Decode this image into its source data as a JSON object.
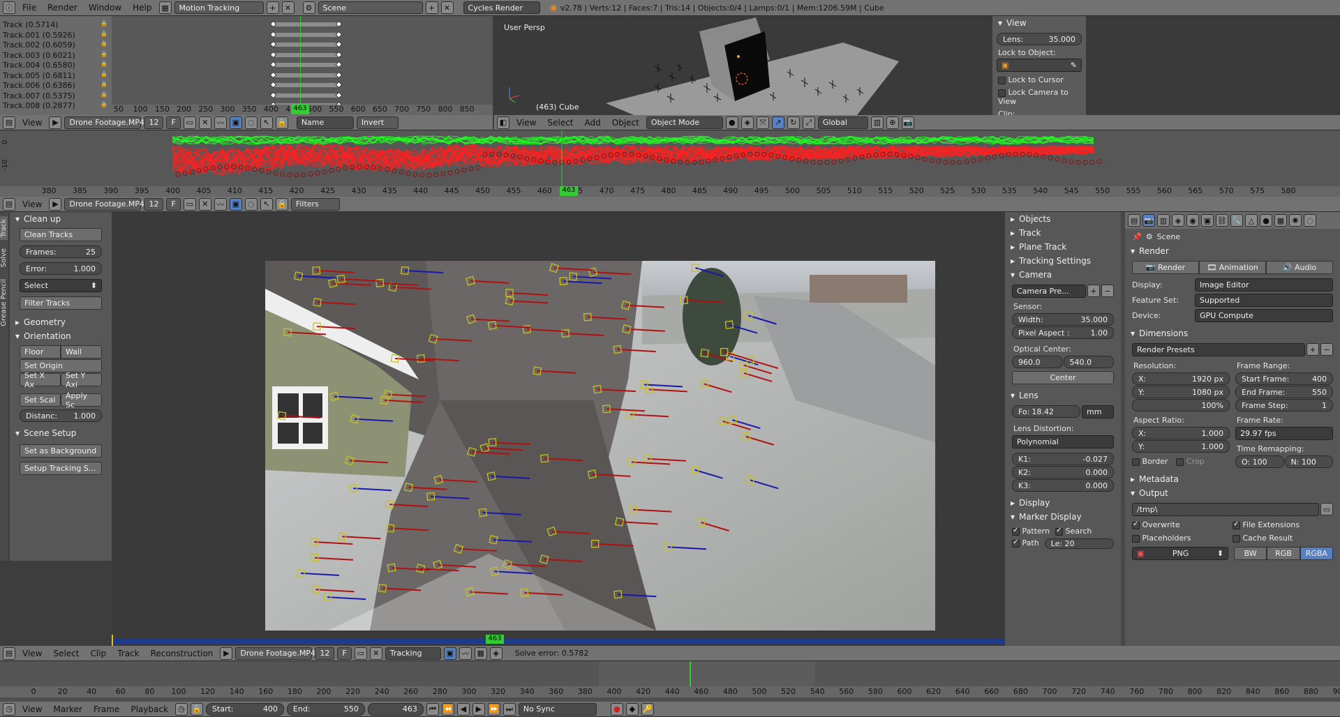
{
  "topbar": {
    "menus": [
      "File",
      "Render",
      "Window",
      "Help"
    ],
    "layout": "Motion Tracking",
    "scene": "Scene",
    "engine": "Cycles Render",
    "stats": "v2.78 | Verts:12 | Faces:7 | Tris:14 | Objects:0/4 | Lamps:0/1 | Mem:1206.59M | Cube"
  },
  "dopesheet": {
    "tracks": [
      "Track (0.5714)",
      "Track.001 (0.5926)",
      "Track.002 (0.6059)",
      "Track.003 (0.6021)",
      "Track.004 (0.6580)",
      "Track.005 (0.6811)",
      "Track.006 (0.6386)",
      "Track.007 (0.5375)",
      "Track.008 (0.2877)"
    ],
    "ruler": [
      "50",
      "100",
      "150",
      "200",
      "250",
      "300",
      "350",
      "400",
      "450",
      "500",
      "550",
      "600",
      "650",
      "700",
      "750",
      "800",
      "850"
    ],
    "current_frame": "463",
    "header": {
      "view": "View",
      "clip": "Drone Footage.MP4",
      "users": "12",
      "fake": "F",
      "sort": "Name",
      "invert": "Invert"
    }
  },
  "viewport": {
    "label": "User Persp",
    "object": "(463) Cube",
    "header": {
      "menus": [
        "View",
        "Select",
        "Add",
        "Object"
      ],
      "mode": "Object Mode",
      "orientation": "Global"
    },
    "npanel": {
      "section": "View",
      "lens_label": "Lens:",
      "lens_value": "35.000",
      "lock_obj": "Lock to Object:",
      "lock_cursor": "Lock to Cursor",
      "lock_camera": "Lock Camera to View",
      "clip": "Clip:"
    }
  },
  "graph": {
    "ylabels": [
      "0",
      "-10"
    ],
    "ruler": [
      "380",
      "385",
      "390",
      "395",
      "400",
      "405",
      "410",
      "415",
      "420",
      "425",
      "430",
      "435",
      "440",
      "445",
      "450",
      "455",
      "460",
      "465",
      "470",
      "475",
      "480",
      "485",
      "490",
      "495",
      "500",
      "505",
      "510",
      "515",
      "520",
      "525",
      "530",
      "535",
      "540",
      "545",
      "550",
      "555",
      "560",
      "565",
      "570",
      "575",
      "580"
    ],
    "current_frame": "463",
    "header": {
      "view": "View",
      "clip": "Drone Footage.MP4",
      "users": "12",
      "fake": "F",
      "filters": "Filters"
    }
  },
  "toolshelf": {
    "tabs": [
      "Track",
      "Solve",
      "Grease Pencil"
    ],
    "cleanup": {
      "title": "Clean up",
      "clean_tracks": "Clean Tracks",
      "frames_label": "Frames:",
      "frames": "25",
      "error_label": "Error:",
      "error": "1.000",
      "select": "Select",
      "filter_tracks": "Filter Tracks"
    },
    "geometry": "Geometry",
    "orientation": {
      "title": "Orientation",
      "floor": "Floor",
      "wall": "Wall",
      "set_origin": "Set Origin",
      "set_x": "Set X Ax",
      "set_y": "Set Y Axi",
      "set_scale": "Set Scal",
      "apply_scale": "Apply Sc",
      "distance_label": "Distanc:",
      "distance": "1.000"
    },
    "scene_setup": {
      "title": "Scene Setup",
      "set_bg": "Set as Background",
      "setup_tracking": "Setup Tracking S..."
    }
  },
  "clip_props": {
    "sections": [
      "Objects",
      "Track",
      "Plane Track",
      "Tracking Settings"
    ],
    "camera": {
      "title": "Camera",
      "preset": "Camera Pre...",
      "sensor": "Sensor:",
      "width_label": "Width:",
      "width": "35.000",
      "pixel_aspect_label": "Pixel Aspect :",
      "pixel_aspect": "1.00",
      "optical_center": "Optical Center:",
      "cx": "960.0",
      "cy": "540.0",
      "center": "Center"
    },
    "lens": {
      "title": "Lens",
      "fo_label": "Fo:",
      "fo": "18.42",
      "unit": "mm",
      "distortion": "Lens Distortion:",
      "model": "Polynomial",
      "k1_label": "K1:",
      "k1": "-0.027",
      "k2_label": "K2:",
      "k2": "0.000",
      "k3_label": "K3:",
      "k3": "0.000"
    },
    "display": "Display",
    "marker_display": {
      "title": "Marker Display",
      "pattern": "Pattern",
      "search": "Search",
      "path": "Path",
      "le": "Le: 20"
    }
  },
  "props": {
    "scene": "Scene",
    "render": {
      "title": "Render",
      "render_btn": "Render",
      "animation_btn": "Animation",
      "audio_btn": "Audio",
      "display_label": "Display:",
      "display": "Image Editor",
      "feature_label": "Feature Set:",
      "feature": "Supported",
      "device_label": "Device:",
      "device": "GPU Compute"
    },
    "dimensions": {
      "title": "Dimensions",
      "presets": "Render Presets",
      "resolution": "Resolution:",
      "x_label": "X:",
      "x": "1920 px",
      "y_label": "Y:",
      "y": "1080 px",
      "pct": "100%",
      "frame_range": "Frame Range:",
      "start_label": "Start Frame:",
      "start": "400",
      "end_label": "End Frame:",
      "end": "550",
      "step_label": "Frame Step:",
      "step": "1",
      "aspect": "Aspect Ratio:",
      "ax": "1.000",
      "ay": "1.000",
      "frame_rate": "Frame Rate:",
      "fps": "29.97 fps",
      "border": "Border",
      "crop": "Crop",
      "remap": "Time Remapping:",
      "o": "O: 100",
      "n": "N: 100"
    },
    "metadata": "Metadata",
    "output": {
      "title": "Output",
      "path": "/tmp\\",
      "overwrite": "Overwrite",
      "file_ext": "File Extensions",
      "placeholders": "Placeholders",
      "cache": "Cache Result",
      "format": "PNG",
      "bw": "BW",
      "rgb": "RGB",
      "rgba": "RGBA"
    }
  },
  "clip_editor": {
    "current_frame": "463",
    "header": {
      "menus": [
        "View",
        "Select",
        "Clip",
        "Track",
        "Reconstruction"
      ],
      "clip": "Drone Footage.MP4",
      "users": "12",
      "fake": "F",
      "mode": "Tracking",
      "solve_error": "Solve error: 0.5782"
    }
  },
  "timeline": {
    "ruler": [
      "0",
      "20",
      "40",
      "60",
      "80",
      "100",
      "120",
      "140",
      "160",
      "180",
      "200",
      "220",
      "240",
      "260",
      "280",
      "300",
      "320",
      "340",
      "360",
      "380",
      "400",
      "420",
      "440",
      "460",
      "480",
      "500",
      "520",
      "540",
      "560",
      "580",
      "600",
      "620",
      "640",
      "660",
      "680",
      "700",
      "720",
      "740",
      "760",
      "780",
      "800",
      "820",
      "840",
      "860",
      "880",
      "900"
    ],
    "header": {
      "menus": [
        "View",
        "Marker",
        "Frame",
        "Playback"
      ],
      "start_label": "Start:",
      "start": "400",
      "end_label": "End:",
      "end": "550",
      "current": "463",
      "sync": "No Sync"
    }
  },
  "colors": {
    "accent": "#5680c2",
    "frame_green": "#33cc33",
    "track_red": "#ff2020",
    "track_green": "#22ff22"
  }
}
